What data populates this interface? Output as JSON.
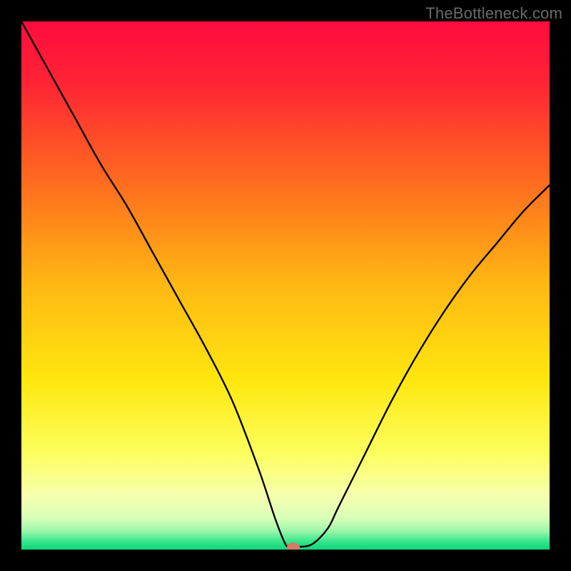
{
  "watermark": "TheBottleneck.com",
  "chart_data": {
    "type": "line",
    "title": "",
    "xlabel": "",
    "ylabel": "",
    "xlim": [
      0,
      100
    ],
    "ylim": [
      0,
      100
    ],
    "background_gradient": {
      "stops": [
        {
          "offset": 0.0,
          "color": "#ff0b3f"
        },
        {
          "offset": 0.12,
          "color": "#ff2534"
        },
        {
          "offset": 0.3,
          "color": "#ff6a1f"
        },
        {
          "offset": 0.5,
          "color": "#ffb813"
        },
        {
          "offset": 0.68,
          "color": "#ffe70e"
        },
        {
          "offset": 0.82,
          "color": "#fcff60"
        },
        {
          "offset": 0.9,
          "color": "#f6ffb0"
        },
        {
          "offset": 0.94,
          "color": "#d8ffb6"
        },
        {
          "offset": 0.965,
          "color": "#9cf7ab"
        },
        {
          "offset": 0.985,
          "color": "#34e58b"
        },
        {
          "offset": 1.0,
          "color": "#0fd47a"
        }
      ]
    },
    "series": [
      {
        "name": "bottleneck-curve",
        "x": [
          0,
          5,
          10,
          15,
          20,
          25,
          30,
          35,
          40,
          45,
          48,
          50,
          51,
          52,
          55,
          58,
          60,
          65,
          70,
          75,
          80,
          85,
          90,
          95,
          100
        ],
        "y": [
          100,
          91,
          82,
          73,
          65,
          56,
          47,
          38,
          28,
          15,
          6,
          1,
          0.5,
          0.5,
          1,
          4,
          8,
          18,
          28,
          37,
          45,
          52,
          58,
          64,
          69
        ]
      }
    ],
    "marker": {
      "name": "optimal-point",
      "x": 51.5,
      "y": 0.5,
      "color": "#d87a68",
      "rx": 9,
      "ry": 6
    }
  }
}
